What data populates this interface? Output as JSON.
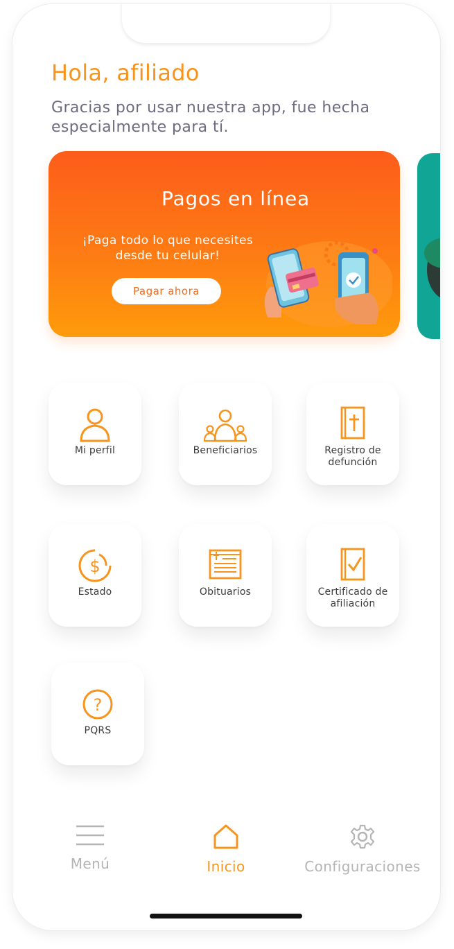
{
  "header": {
    "greeting": "Hola, afiliado",
    "subtitle": "Gracias por usar nuestra app, fue hecha especialmente para tí."
  },
  "banner": {
    "title": "Pagos en línea",
    "description": "¡Paga todo lo que necesites desde tu celular!",
    "button_label": "Pagar ahora"
  },
  "tiles": [
    {
      "label": "Mi perfil",
      "icon": "user-icon"
    },
    {
      "label": "Beneficiarios",
      "icon": "beneficiaries-icon"
    },
    {
      "label": "Registro de defunción",
      "icon": "death-record-icon"
    },
    {
      "label": "Estado",
      "icon": "dollar-status-icon"
    },
    {
      "label": "Obituarios",
      "icon": "obituary-icon"
    },
    {
      "label": "Certificado de afiliación",
      "icon": "certificate-icon"
    },
    {
      "label": "PQRS",
      "icon": "question-icon"
    }
  ],
  "nav": {
    "menu": "Menú",
    "home": "Inicio",
    "settings": "Configuraciones"
  },
  "colors": {
    "accent": "#f7941d",
    "banner_start": "#fd5d1a",
    "banner_end": "#fe9b0b",
    "peek_card": "#10a594"
  }
}
